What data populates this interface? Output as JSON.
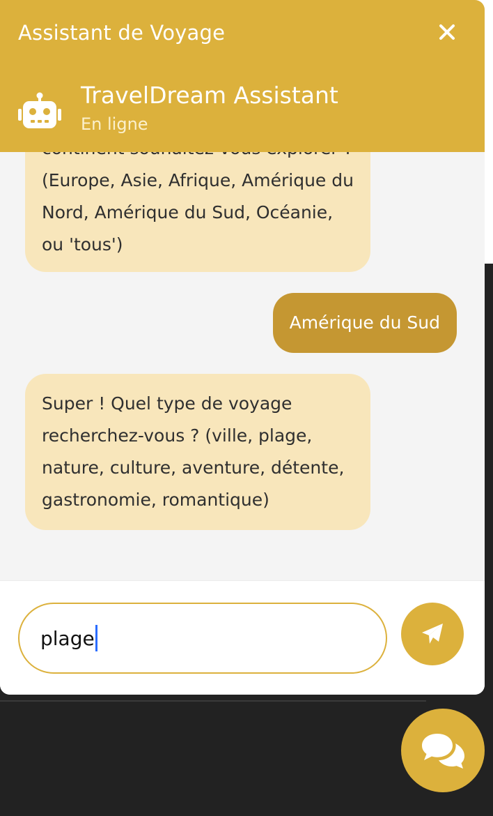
{
  "header": {
    "title": "Assistant de Voyage",
    "close_icon": "close-icon",
    "bot_name": "TravelDream Assistant",
    "bot_status": "En ligne",
    "avatar_icon": "robot-icon"
  },
  "messages": [
    {
      "sender": "bot",
      "text": "continent souhaitez-vous explorer ? (Europe, Asie, Afrique, Amérique du Nord, Amérique du Sud, Océanie, ou 'tous')"
    },
    {
      "sender": "user",
      "text": "Amérique du Sud"
    },
    {
      "sender": "bot",
      "text": "Super ! Quel type de voyage recherchez-vous ? (ville, plage, nature, culture, aventure, détente, gastronomie, romantique)"
    }
  ],
  "composer": {
    "input_value": "plage",
    "send_icon": "paper-plane-icon"
  },
  "launcher": {
    "icon": "chat-bubbles-icon"
  },
  "colors": {
    "accent": "#dcb13c",
    "user_bubble": "#c59732",
    "bot_bubble": "#f8e6bb",
    "chat_background": "#f4f4f4",
    "page_background": "#222222"
  }
}
